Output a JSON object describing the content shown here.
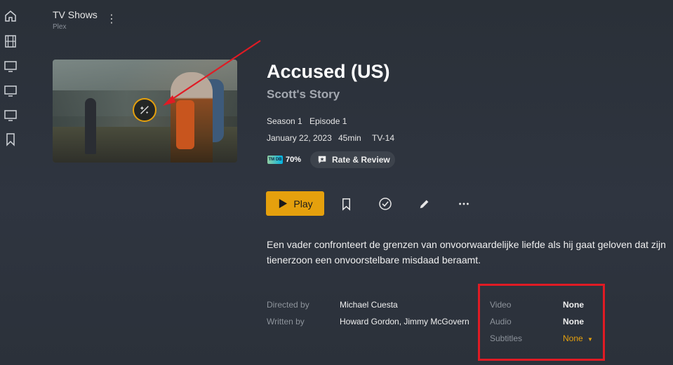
{
  "sidebar": {
    "items": [
      {
        "icon": "home-icon"
      },
      {
        "icon": "film-icon"
      },
      {
        "icon": "tv-icon"
      },
      {
        "icon": "tv-icon"
      },
      {
        "icon": "tv-icon"
      },
      {
        "icon": "bookmark-icon"
      }
    ]
  },
  "library": {
    "title": "TV Shows",
    "subtitle": "Plex",
    "more_label": "⋮"
  },
  "episode": {
    "show_title": "Accused (US)",
    "episode_title": "Scott's Story",
    "season": "Season 1",
    "episode": "Episode 1",
    "air_date": "January 22, 2023",
    "runtime": "45min",
    "content_rating": "TV-14",
    "tmdb_logo": "TM DB",
    "tmdb_score": "70%",
    "rate_review_label": "Rate & Review",
    "description": "Een vader confronteert de grenzen van onvoorwaardelijke liefde als hij gaat geloven dat zijn tienerzoon een onvoorstelbare misdaad beraamt."
  },
  "actions": {
    "play_label": "Play",
    "icons": [
      "bookmark-icon",
      "check-circle-icon",
      "pencil-icon",
      "more-horizontal-icon"
    ]
  },
  "credits": [
    {
      "label": "Directed by",
      "value": "Michael Cuesta"
    },
    {
      "label": "Written by",
      "value": "Howard Gordon, Jimmy McGovern"
    }
  ],
  "streams": {
    "video_label": "Video",
    "video_value": "None",
    "audio_label": "Audio",
    "audio_value": "None",
    "subtitles_label": "Subtitles",
    "subtitles_value": "None"
  },
  "colors": {
    "accent": "#e5a00d",
    "annotation": "#e01b24",
    "background": "#2e343d"
  }
}
